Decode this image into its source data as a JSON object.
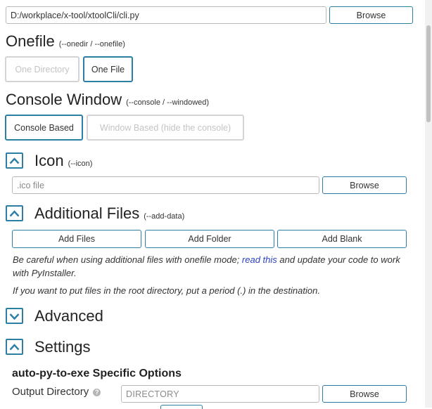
{
  "script_location": {
    "value": "D:/workplace/x-tool/xtoolCli/cli.py",
    "browse_label": "Browse"
  },
  "onefile": {
    "title": "Onefile",
    "hint": "(--onedir / --onefile)",
    "options": [
      "One Directory",
      "One File"
    ],
    "selected": "One File"
  },
  "console_window": {
    "title": "Console Window",
    "hint": "(--console / --windowed)",
    "options": [
      "Console Based",
      "Window Based (hide the console)"
    ],
    "selected": "Console Based"
  },
  "icon_section": {
    "title": "Icon",
    "hint": "(--icon)",
    "placeholder": ".ico file",
    "browse_label": "Browse",
    "state": "expanded"
  },
  "additional_files": {
    "title": "Additional Files",
    "hint": "(--add-data)",
    "buttons": [
      "Add Files",
      "Add Folder",
      "Add Blank"
    ],
    "note_before_link": "Be careful when using additional files with onefile mode; ",
    "note_link": "read this",
    "note_after_link": " and update your code to work with PyInstaller.",
    "note2": "If you want to put files in the root directory, put a period (.) in the destination.",
    "state": "expanded"
  },
  "advanced": {
    "title": "Advanced",
    "state": "collapsed"
  },
  "settings": {
    "title": "Settings",
    "state": "expanded",
    "subheading": "auto-py-to-exe Specific Options",
    "output_dir_label": "Output Directory",
    "output_dir_placeholder": "DIRECTORY",
    "browse_label": "Browse"
  },
  "colors": {
    "accent": "#2d7ea3",
    "link": "#2a3fc4",
    "disabled": "#d4d4d4"
  }
}
